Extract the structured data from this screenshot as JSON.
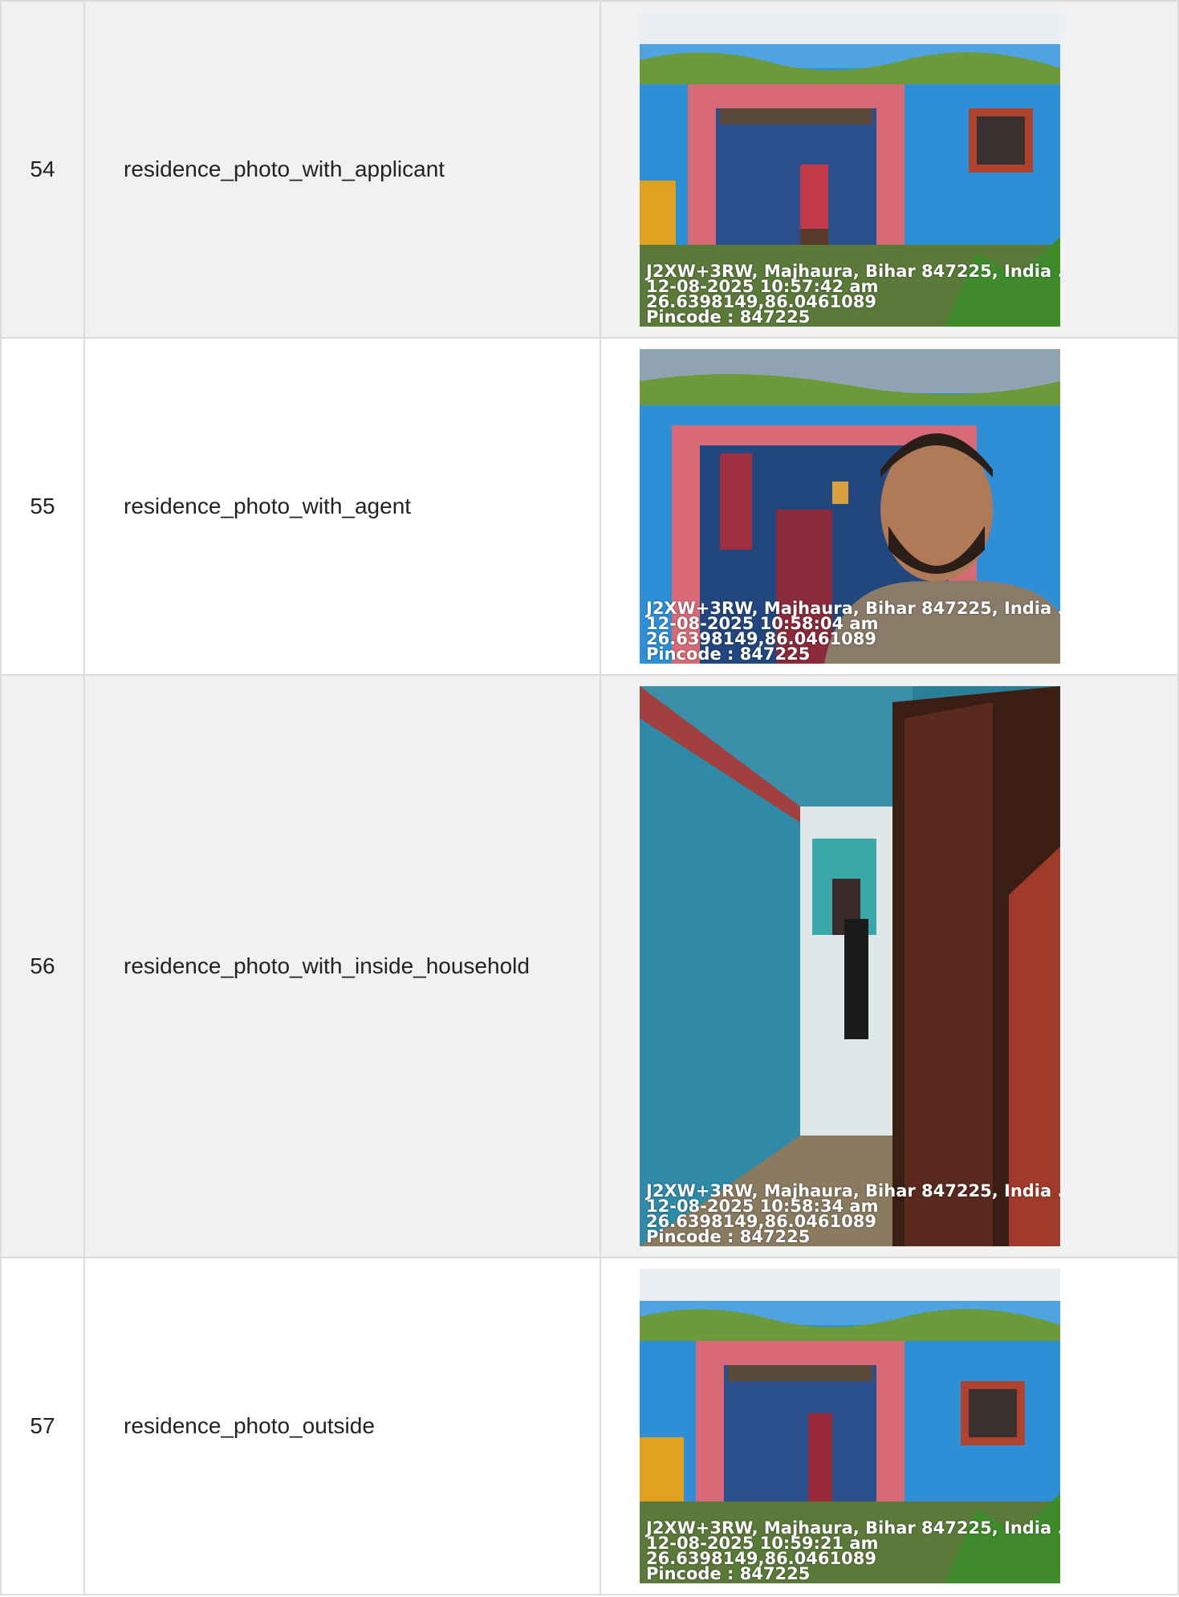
{
  "rows": [
    {
      "number": "54",
      "label": "residence_photo_with_applicant",
      "photo": {
        "description_icon": "house-front-photo",
        "stamp": [
          "J2XW+3RW, Majhaura, Bihar 847225, India ..",
          "12-08-2025 10:57:42 am",
          "26.6398149,86.0461089",
          "Pincode : 847225"
        ]
      }
    },
    {
      "number": "55",
      "label": "residence_photo_with_agent",
      "photo": {
        "description_icon": "agent-selfie-photo",
        "stamp": [
          "J2XW+3RW, Majhaura, Bihar 847225, India ..",
          "12-08-2025 10:58:04 am",
          "26.6398149,86.0461089",
          "Pincode : 847225"
        ]
      }
    },
    {
      "number": "56",
      "label": "residence_photo_with_inside_household",
      "photo": {
        "description_icon": "corridor-photo",
        "stamp": [
          "J2XW+3RW, Majhaura, Bihar 847225, India ..",
          "12-08-2025 10:58:34 am",
          "26.6398149,86.0461089",
          "Pincode : 847225"
        ]
      }
    },
    {
      "number": "57",
      "label": "residence_photo_outside",
      "photo": {
        "description_icon": "house-front-photo",
        "stamp": [
          "J2XW+3RW, Majhaura, Bihar 847225, India ..",
          "12-08-2025 10:59:21 am",
          "26.6398149,86.0461089",
          "Pincode : 847225"
        ]
      }
    }
  ]
}
